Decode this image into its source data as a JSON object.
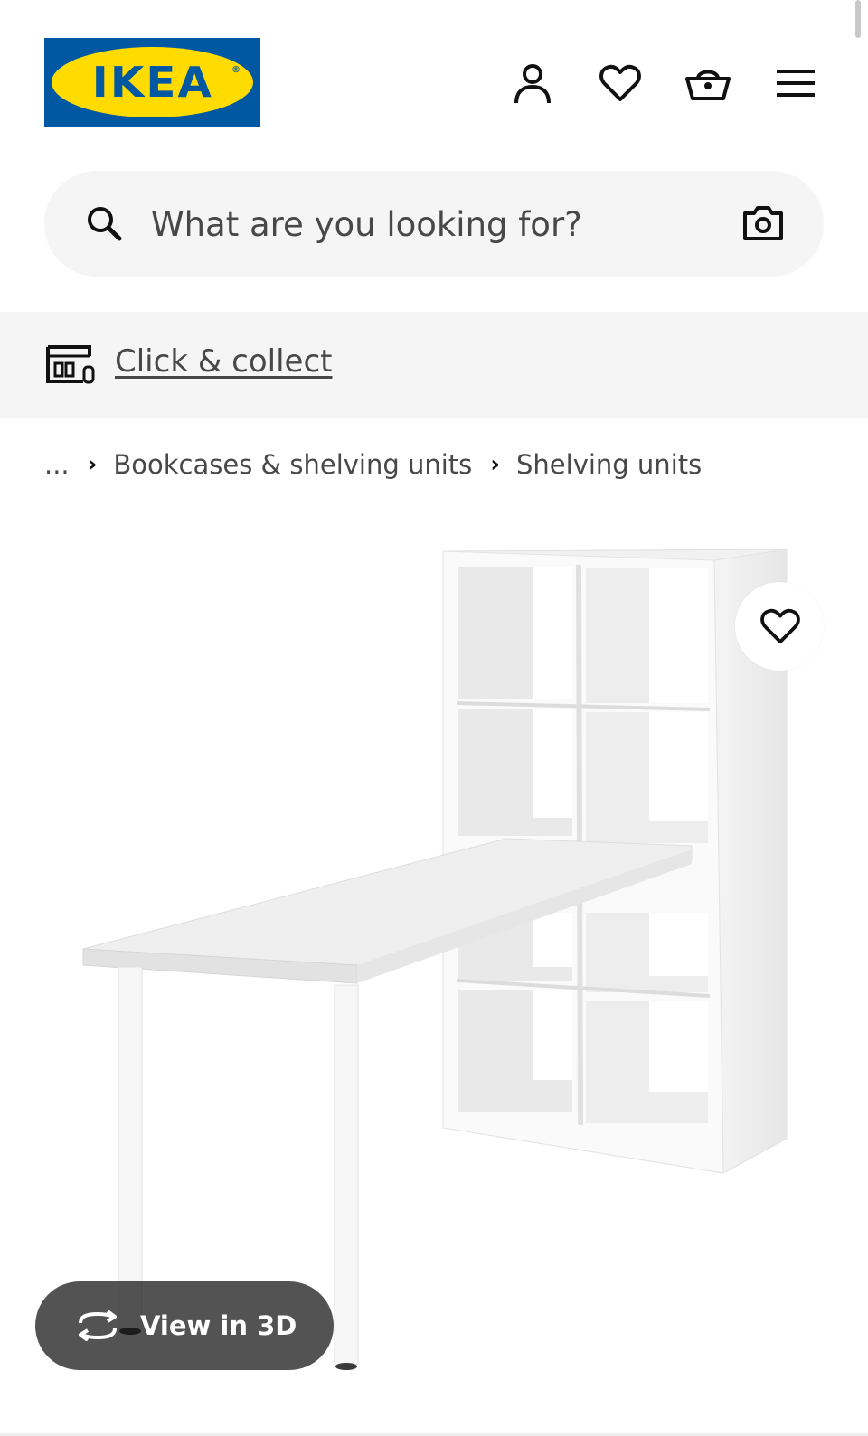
{
  "brand": {
    "logo_text": "IKEA",
    "logo_mark": "®",
    "colors": {
      "blue": "#0058A3",
      "yellow": "#FFDB00"
    }
  },
  "header": {
    "icons": [
      "user-icon",
      "heart-icon",
      "basket-icon",
      "menu-icon"
    ]
  },
  "search": {
    "placeholder": "What are you looking for?",
    "icons": [
      "search-icon",
      "camera-icon"
    ]
  },
  "store_bar": {
    "link_label": "Click & collect",
    "icon": "store-icon"
  },
  "breadcrumb": {
    "ellipsis": "...",
    "items": [
      "Bookcases & shelving units",
      "Shelving units"
    ]
  },
  "product_media": {
    "favourite_icon": "heart-icon",
    "view_3d_label": "View in 3D",
    "view_3d_icon": "rotate-3d-icon"
  }
}
